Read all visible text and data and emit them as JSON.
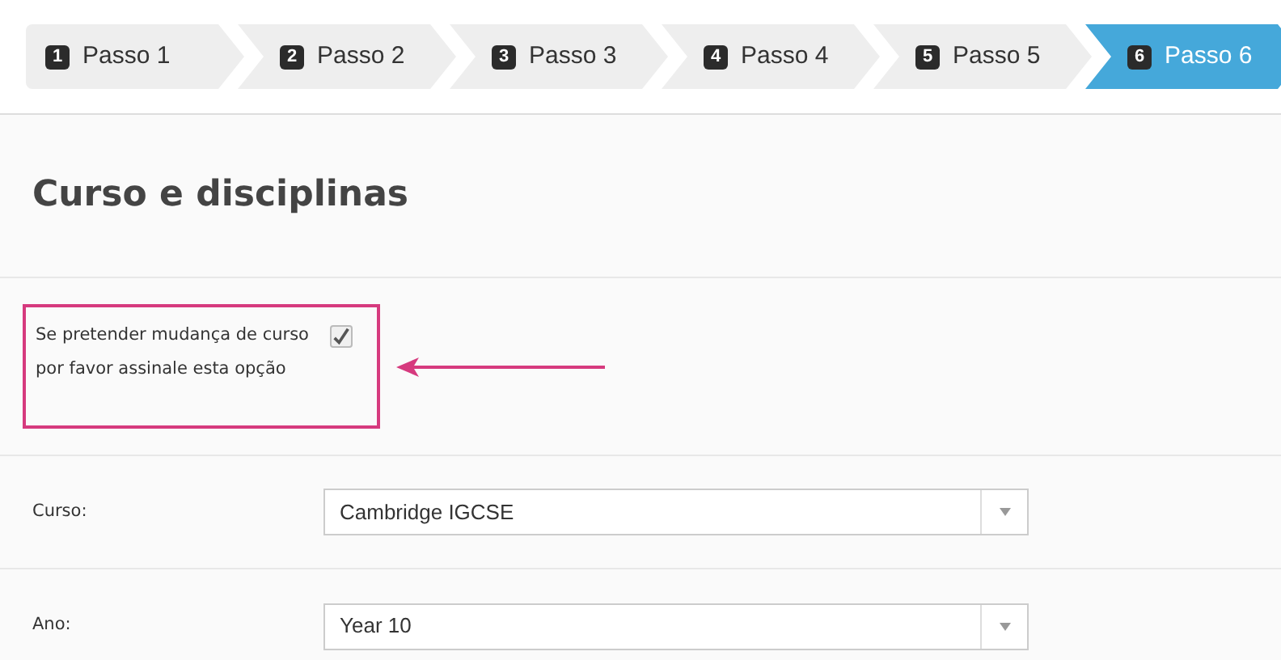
{
  "steps": [
    {
      "number": "1",
      "label": "Passo 1",
      "selected": false
    },
    {
      "number": "2",
      "label": "Passo 2",
      "selected": false
    },
    {
      "number": "3",
      "label": "Passo 3",
      "selected": false
    },
    {
      "number": "4",
      "label": "Passo 4",
      "selected": false
    },
    {
      "number": "5",
      "label": "Passo 5",
      "selected": false
    },
    {
      "number": "6",
      "label": "Passo 6",
      "selected": true
    }
  ],
  "section_title": "Curso e disciplinas",
  "change_course": {
    "label": "Se pretender mudança de curso por favor assinale esta opção",
    "checked": true
  },
  "fields": [
    {
      "label": "Curso:",
      "value": "Cambridge IGCSE"
    },
    {
      "label": "Ano:",
      "value": "Year 10"
    }
  ]
}
